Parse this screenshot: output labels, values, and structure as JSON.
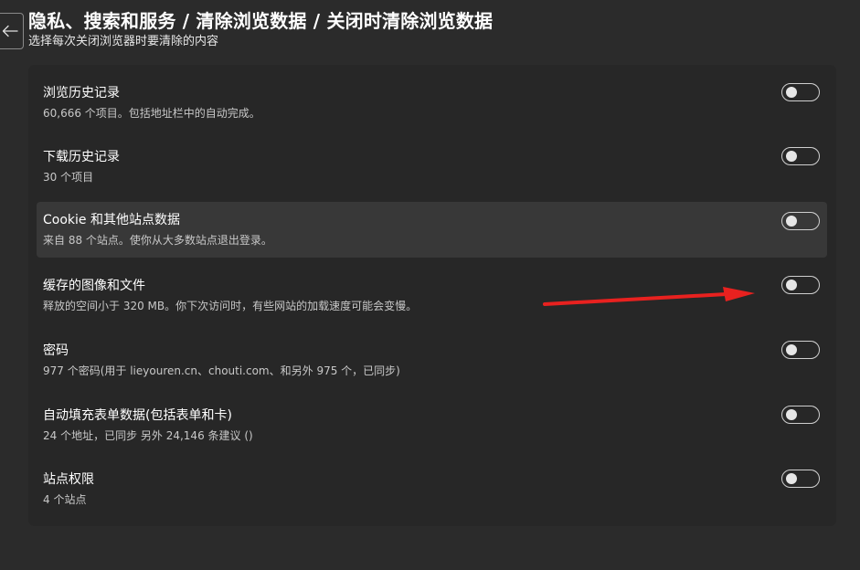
{
  "header": {
    "title": "隐私、搜索和服务 / 清除浏览数据 / 关闭时清除浏览数据",
    "subtitle": "选择每次关闭浏览器时要清除的内容"
  },
  "items": [
    {
      "title": "浏览历史记录",
      "desc": "60,666 个项目。包括地址栏中的自动完成。",
      "enabled": false
    },
    {
      "title": "下载历史记录",
      "desc": "30 个项目",
      "enabled": false
    },
    {
      "title": "Cookie 和其他站点数据",
      "desc": "来自 88 个站点。使你从大多数站点退出登录。",
      "enabled": false
    },
    {
      "title": "缓存的图像和文件",
      "desc": "释放的空间小于 320 MB。你下次访问时，有些网站的加载速度可能会变慢。",
      "enabled": false
    },
    {
      "title": "密码",
      "desc": "977 个密码(用于 lieyouren.cn、chouti.com、和另外 975 个，已同步)",
      "enabled": false
    },
    {
      "title": "自动填充表单数据(包括表单和卡)",
      "desc": "24 个地址，已同步 另外 24,146 条建议 ()",
      "enabled": false
    },
    {
      "title": "站点权限",
      "desc": "4 个站点",
      "enabled": false
    }
  ],
  "colors": {
    "background": "#2b2b2b",
    "card": "#272727",
    "highlight_row": "#383838",
    "annotation_arrow": "#e8211f"
  }
}
